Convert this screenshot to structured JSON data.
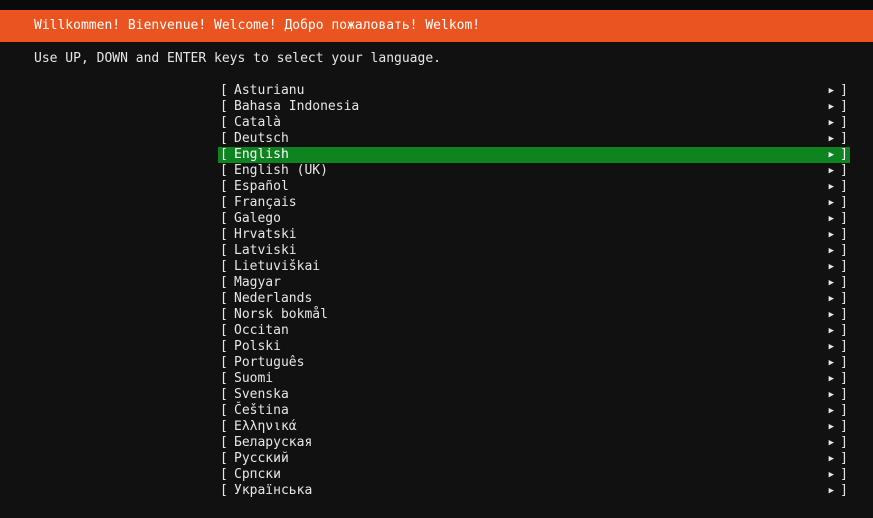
{
  "banner": {
    "title": "Willkommen! Bienvenue! Welcome! Добро пожаловать! Welkom!"
  },
  "instruction": "Use UP, DOWN and ENTER keys to select your language.",
  "glyphs": {
    "left_bracket": "[",
    "right_bracket": "]",
    "arrow": "▶"
  },
  "colors": {
    "banner": "#e95420",
    "selected_row": "#0e8420",
    "background": "#111111",
    "text": "#e6e6e6"
  },
  "languages": [
    {
      "label": "Asturianu",
      "selected": false
    },
    {
      "label": "Bahasa Indonesia",
      "selected": false
    },
    {
      "label": "Català",
      "selected": false
    },
    {
      "label": "Deutsch",
      "selected": false
    },
    {
      "label": "English",
      "selected": true
    },
    {
      "label": "English (UK)",
      "selected": false
    },
    {
      "label": "Español",
      "selected": false
    },
    {
      "label": "Français",
      "selected": false
    },
    {
      "label": "Galego",
      "selected": false
    },
    {
      "label": "Hrvatski",
      "selected": false
    },
    {
      "label": "Latviski",
      "selected": false
    },
    {
      "label": "Lietuviškai",
      "selected": false
    },
    {
      "label": "Magyar",
      "selected": false
    },
    {
      "label": "Nederlands",
      "selected": false
    },
    {
      "label": "Norsk bokmål",
      "selected": false
    },
    {
      "label": "Occitan",
      "selected": false
    },
    {
      "label": "Polski",
      "selected": false
    },
    {
      "label": "Português",
      "selected": false
    },
    {
      "label": "Suomi",
      "selected": false
    },
    {
      "label": "Svenska",
      "selected": false
    },
    {
      "label": "Čeština",
      "selected": false
    },
    {
      "label": "Ελληνικά",
      "selected": false
    },
    {
      "label": "Беларуская",
      "selected": false
    },
    {
      "label": "Русский",
      "selected": false
    },
    {
      "label": "Српски",
      "selected": false
    },
    {
      "label": "Українська",
      "selected": false
    }
  ]
}
